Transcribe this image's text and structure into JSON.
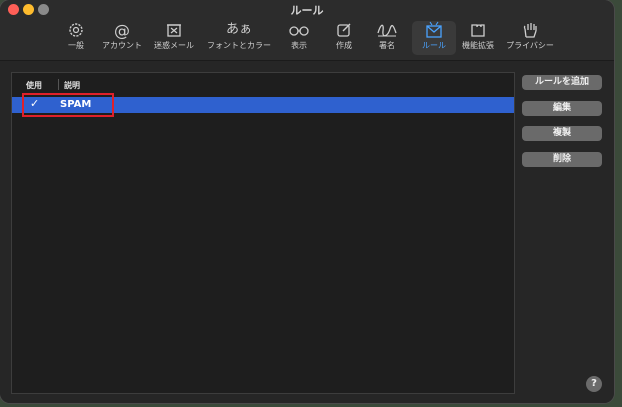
{
  "window": {
    "title": "ルール"
  },
  "toolbar": {
    "items": [
      {
        "label": "一般",
        "icon": "gear-icon"
      },
      {
        "label": "アカウント",
        "icon": "at-icon"
      },
      {
        "label": "迷惑メール",
        "icon": "junk-icon"
      },
      {
        "label": "フォントとカラー",
        "icon": "fonts-icon",
        "glyph": "あぁ"
      },
      {
        "label": "表示",
        "icon": "glasses-icon"
      },
      {
        "label": "作成",
        "icon": "compose-icon"
      },
      {
        "label": "署名",
        "icon": "signature-icon"
      },
      {
        "label": "ルール",
        "icon": "rules-icon",
        "active": true
      },
      {
        "label": "機能拡張",
        "icon": "puzzle-icon"
      },
      {
        "label": "プライバシー",
        "icon": "hand-icon"
      }
    ]
  },
  "rules_table": {
    "headers": {
      "use": "使用",
      "description": "説明"
    },
    "rows": [
      {
        "enabled": true,
        "check_mark": "✓",
        "description": "SPAM"
      }
    ]
  },
  "buttons": {
    "add_rule": "ルールを追加",
    "edit": "編集",
    "duplicate": "複製",
    "delete": "削除"
  },
  "help": {
    "label": "?"
  },
  "colors": {
    "accent": "#4aa3ff",
    "selection": "#2f61cf",
    "highlight": "#e0202a"
  }
}
